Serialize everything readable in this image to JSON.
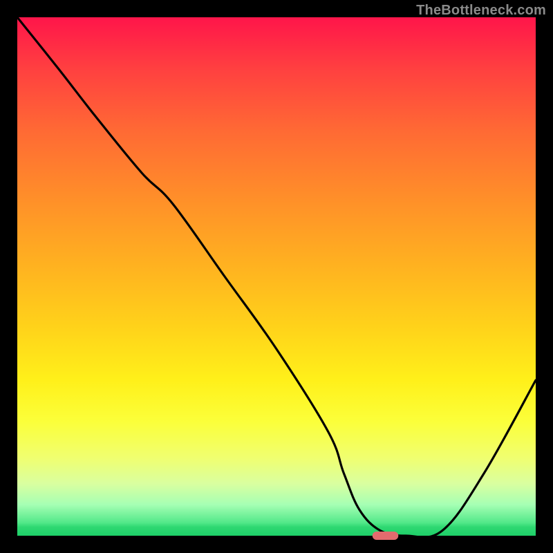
{
  "watermark": "TheBottleneck.com",
  "chart_data": {
    "type": "line",
    "title": "",
    "xlabel": "",
    "ylabel": "",
    "xlim": [
      0,
      100
    ],
    "ylim": [
      0,
      100
    ],
    "x": [
      0,
      8,
      15,
      24,
      30,
      40,
      50,
      60,
      63,
      66,
      70,
      75,
      82,
      90,
      100
    ],
    "values": [
      100,
      90,
      81,
      70,
      64,
      50,
      36,
      20,
      12,
      5,
      1,
      0,
      1,
      12,
      30
    ],
    "marker": {
      "x": 71,
      "y": 0,
      "color": "#e36b6e",
      "width": 5,
      "height": 1.6
    },
    "background_gradient": "rainbow_vertical_red_to_green"
  }
}
